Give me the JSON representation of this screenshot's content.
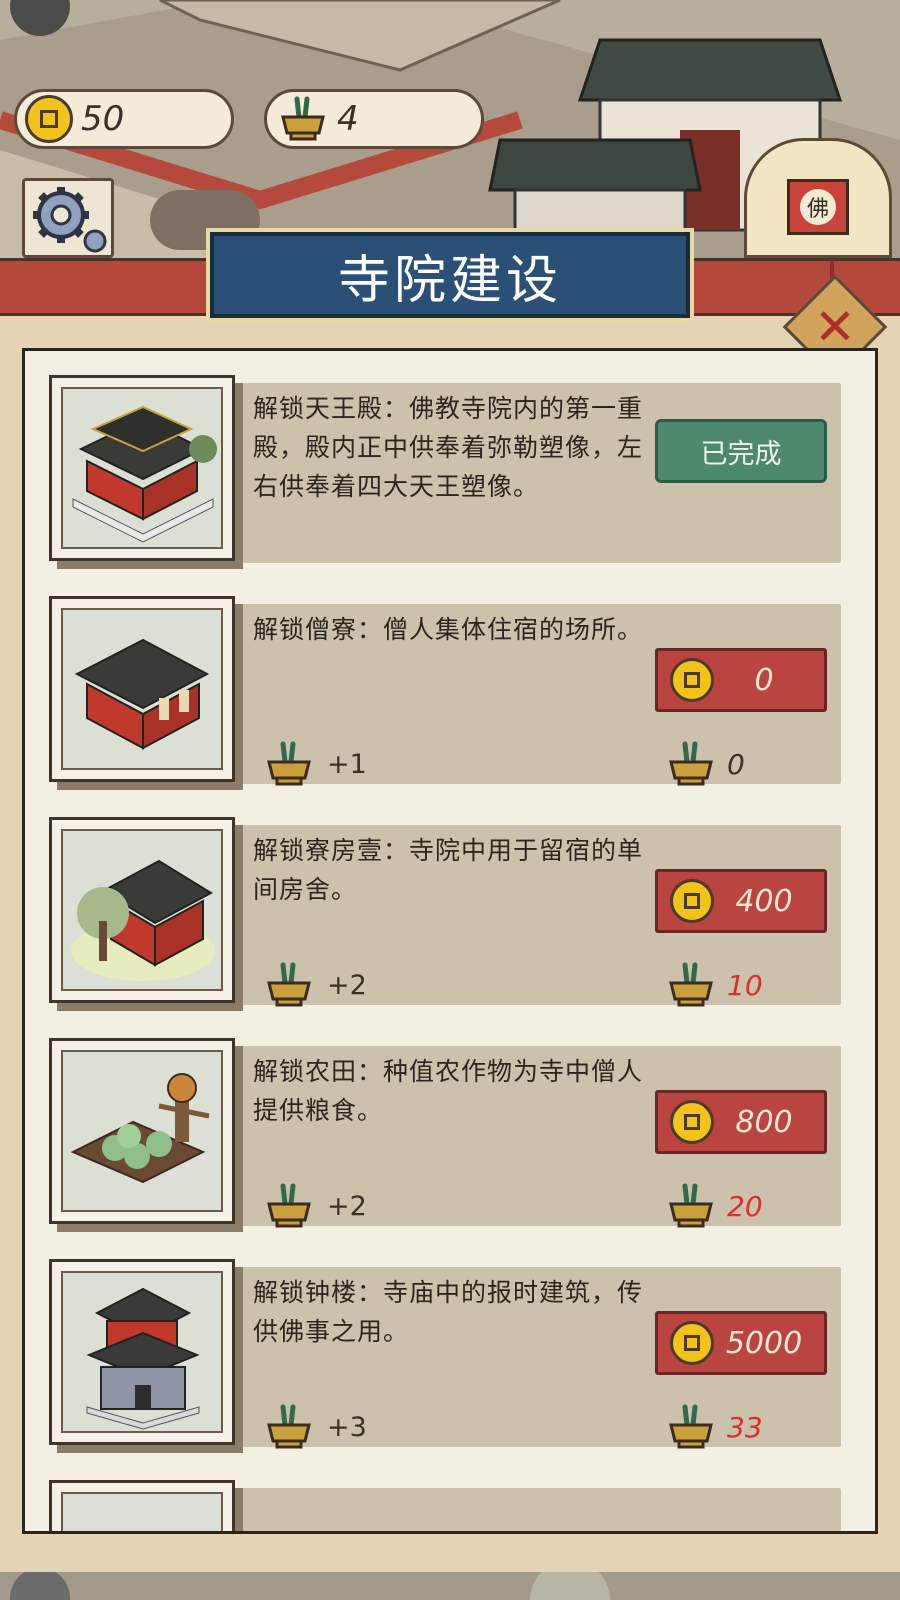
{
  "hud": {
    "coins": "50",
    "incense": "4",
    "gear_icon": "gear-icon",
    "fo_sign": "佛"
  },
  "title": "寺院建设",
  "close_icon": "✕",
  "colors": {
    "accent_red": "#b94440",
    "done_green": "#4c8a6b",
    "title_blue": "#2b5077",
    "insufficient_red": "#d8302a"
  },
  "items": [
    {
      "desc": "解锁天王殿：佛教寺院内的第一重殿，殿内正中供奉着弥勒塑像，左右供奉着四大天王塑像。",
      "status": "已完成"
    },
    {
      "desc": "解锁僧寮：僧人集体住宿的场所。",
      "reward": "+1",
      "cost": "0",
      "required": "0"
    },
    {
      "desc": "解锁寮房壹：寺院中用于留宿的单间房舍。",
      "reward": "+2",
      "cost": "400",
      "required": "10"
    },
    {
      "desc": "解锁农田：种值农作物为寺中僧人提供粮食。",
      "reward": "+2",
      "cost": "800",
      "required": "20"
    },
    {
      "desc": "解锁钟楼：寺庙中的报时建筑，传供佛事之用。",
      "reward": "+3",
      "cost": "5000",
      "required": "33"
    }
  ]
}
